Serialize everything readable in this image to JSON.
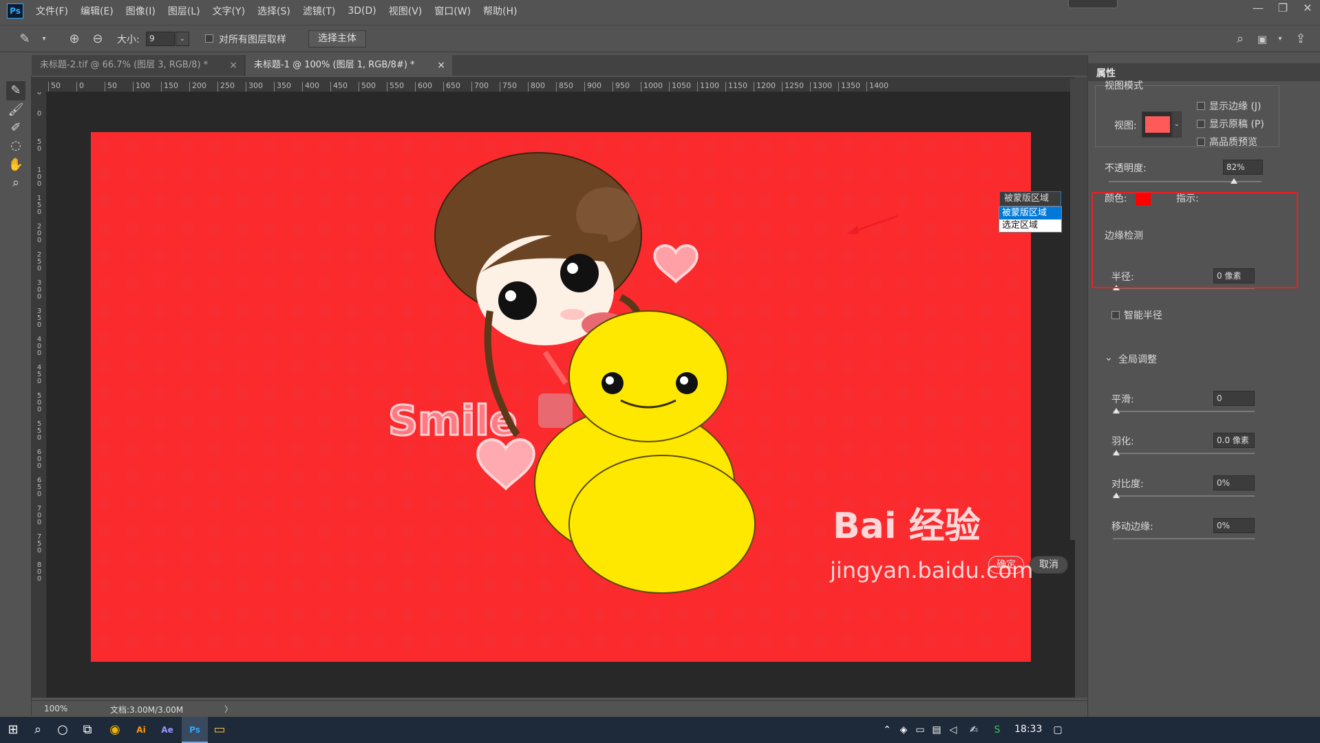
{
  "app": {
    "logo": "Ps",
    "menu": [
      "文件(F)",
      "编辑(E)",
      "图像(I)",
      "图层(L)",
      "文字(Y)",
      "选择(S)",
      "滤镜(T)",
      "3D(D)",
      "视图(V)",
      "窗口(W)",
      "帮助(H)"
    ],
    "window_controls": [
      "—",
      "❐",
      "✕"
    ]
  },
  "options_bar": {
    "size_label": "大小:",
    "size_value": "9",
    "sample_all_label": "对所有图层取样",
    "select_subject_label": "选择主体"
  },
  "tabs": [
    {
      "label": "未标题-2.tif @ 66.7% (图层 3, RGB/8) *",
      "close": "×"
    },
    {
      "label": "未标题-1 @ 100% (图层 1, RGB/8#) *",
      "close": "×"
    }
  ],
  "ruler_top": [
    "50",
    "0",
    "50",
    "100",
    "150",
    "200",
    "250",
    "300",
    "350",
    "400",
    "450",
    "500",
    "550",
    "600",
    "650",
    "700",
    "750",
    "800",
    "850",
    "900",
    "950",
    "1000",
    "1050",
    "1100",
    "1150",
    "1200",
    "1250",
    "1300",
    "1350",
    "1400"
  ],
  "ruler_left": [
    "50",
    "0",
    "50",
    "100",
    "150",
    "200",
    "250",
    "300",
    "350",
    "400",
    "450",
    "500",
    "550",
    "600",
    "650",
    "700",
    "750",
    "800"
  ],
  "canvas": {
    "background": "#fa2a2d",
    "smile_text": "Smile"
  },
  "status": {
    "zoom": "100%",
    "doc_info": "文档:3.00M/3.00M",
    "arrow": "〉"
  },
  "properties": {
    "title": "属性",
    "view_mode_label": "视图模式",
    "view_label": "视图:",
    "show_edge": "显示边缘 (J)",
    "show_original": "显示原稿 (P)",
    "hq_preview": "高品质预览",
    "opacity_label": "不透明度:",
    "opacity_value": "82%",
    "opacity_level": 0.82,
    "color_label": "颜色:",
    "indicate_label": "指示:",
    "indicate_value": "被蒙版区域",
    "indicate_options": [
      "被蒙版区域",
      "选定区域"
    ],
    "edge_detection": "边缘检测",
    "radius_label": "半径:",
    "radius_value": "0 像素",
    "smart_radius": "智能半径",
    "global_adjust": "全局调整",
    "smooth_label": "平滑:",
    "smooth_value": "0",
    "feather_label": "羽化:",
    "feather_value": "0.0 像素",
    "contrast_label": "对比度:",
    "contrast_value": "0%",
    "shift_edge_label": "移动边缘:",
    "shift_edge_value": "0%",
    "ok": "确定",
    "cancel": "取消"
  },
  "taskbar": {
    "clock": "18:33"
  },
  "watermark": {
    "logo": "Bai 经验",
    "url": "jingyan.baidu.com"
  },
  "colors": {
    "accent": "#31a8ff",
    "highlight_box": "#f01d24",
    "swatch": "#ff0000",
    "duck": "#ffe800",
    "hair": "#6b4423"
  }
}
